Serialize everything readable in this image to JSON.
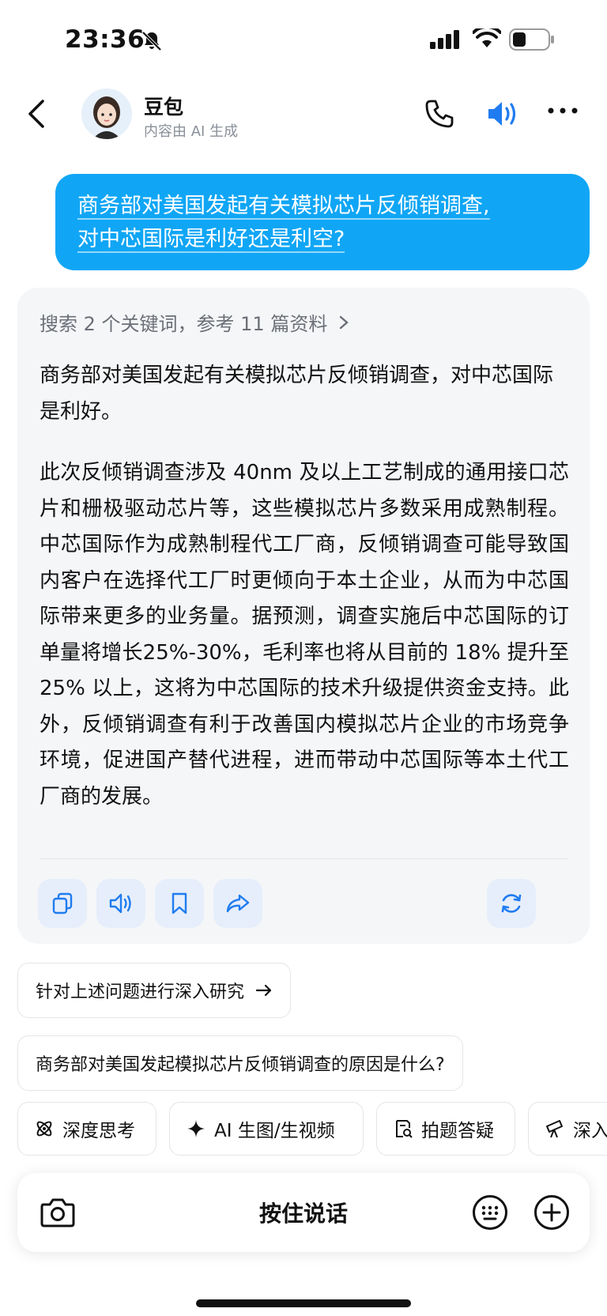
{
  "status": {
    "time": "23:36"
  },
  "header": {
    "name": "豆包",
    "subtitle": "内容由 AI 生成"
  },
  "user_message": {
    "line1": "商务部对美国发起有关模拟芯片反倾销调查,",
    "line2": "对中芯国际是利好还是利空?"
  },
  "bot": {
    "search_summary": "搜索 2 个关键词，参考 11 篇资料",
    "paragraph1": "商务部对美国发起有关模拟芯片反倾销调查，对中芯国际是利好。",
    "paragraph2": "此次反倾销调查涉及 40nm 及以上工艺制成的通用接口芯片和栅极驱动芯片等，这些模拟芯片多数采用成熟制程。中芯国际作为成熟制程代工厂商，反倾销调查可能导致国内客户在选择代工厂时更倾向于本土企业，从而为中芯国际带来更多的业务量。据预测，调查实施后中芯国际的订单量将增长25%-30%，毛利率也将从目前的 18% 提升至 25% 以上，这将为中芯国际的技术升级提供资金支持。此外，反倾销调查有利于改善国内模拟芯片企业的市场竞争环境，促进国产替代进程，进而带动中芯国际等本土代工厂商的发展。"
  },
  "suggestions": {
    "deep_research": "针对上述问题进行深入研究",
    "question": "商务部对美国发起模拟芯片反倾销调查的原因是什么?"
  },
  "tools": {
    "deep_think": "深度思考",
    "ai_image": "AI 生图/生视频",
    "photo_qa": "拍题答疑",
    "deep_more": "深入"
  },
  "input": {
    "hold_to_talk": "按住说话"
  },
  "colors": {
    "accent": "#10a6f5",
    "icon_blue": "#1f7cf0",
    "card_bg": "#f5f6f8"
  }
}
